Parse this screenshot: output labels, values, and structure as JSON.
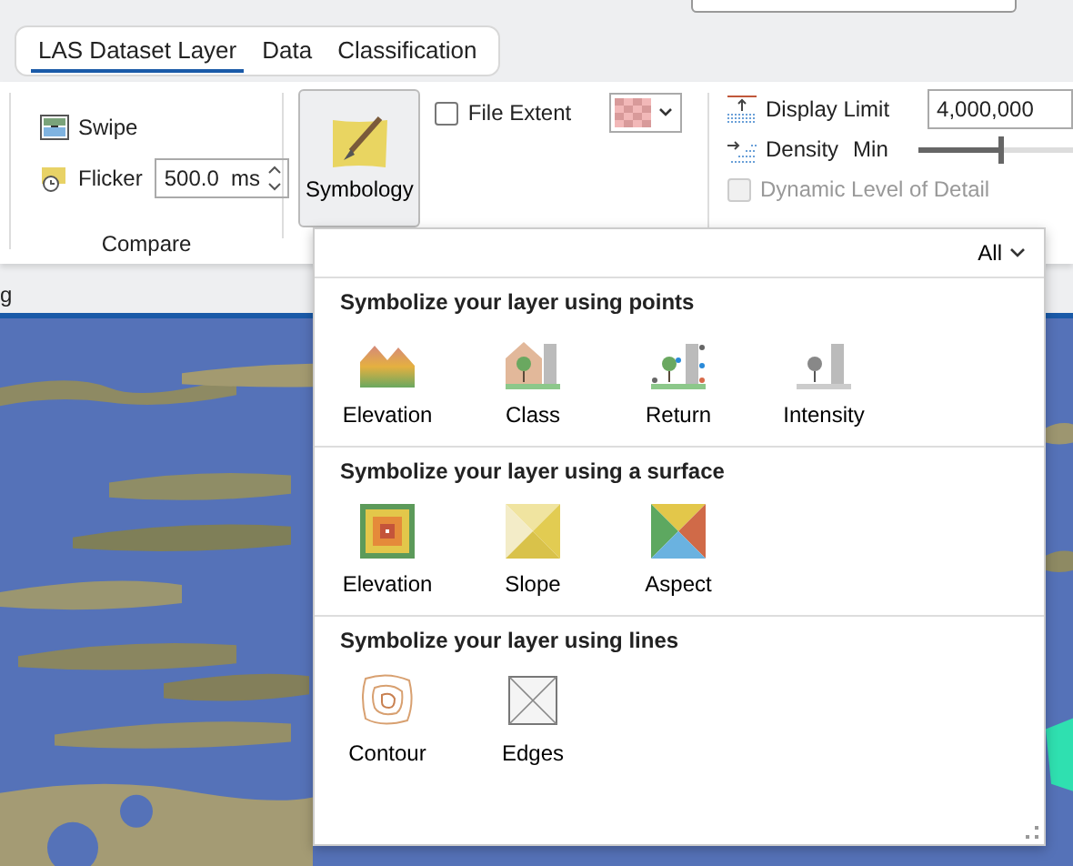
{
  "tabs": [
    {
      "label": "LAS Dataset Layer",
      "selected": true
    },
    {
      "label": "Data",
      "selected": false
    },
    {
      "label": "Classification",
      "selected": false
    }
  ],
  "compare": {
    "swipe": "Swipe",
    "flicker": "Flicker",
    "flicker_value": "500.0  ms",
    "label": "Compare"
  },
  "symbology_button": {
    "label": "Symbology",
    "pressed": true
  },
  "file_extent": {
    "label": "File Extent",
    "checked": false
  },
  "display": {
    "display_limit": "Display Limit",
    "limit_value": "4,000,000",
    "density": "Density",
    "density_min": "Min",
    "density_slider": {
      "level": 0.45
    },
    "dynamic_lod": {
      "label": "Dynamic Level of Detail",
      "checked": false,
      "disabled": true
    }
  },
  "map_tab": {
    "label": "g"
  },
  "popup": {
    "filter": "All",
    "sections": [
      {
        "title": "Symbolize your layer using points",
        "items": [
          "Elevation",
          "Class",
          "Return",
          "Intensity"
        ]
      },
      {
        "title": "Symbolize your layer using a surface",
        "items": [
          "Elevation",
          "Slope",
          "Aspect"
        ]
      },
      {
        "title": "Symbolize your layer using lines",
        "items": [
          "Contour",
          "Edges"
        ]
      }
    ]
  }
}
